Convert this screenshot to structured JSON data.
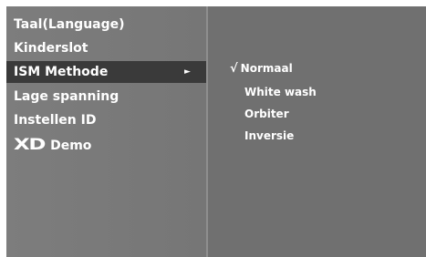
{
  "menu": {
    "items": [
      {
        "label": "Taal(Language)"
      },
      {
        "label": "Kinderslot"
      },
      {
        "label": "ISM Methode"
      },
      {
        "label": "Lage spanning"
      },
      {
        "label": "Instellen ID"
      },
      {
        "label": "Demo",
        "logo": "XD"
      }
    ],
    "selected_index": 2,
    "selected_arrow": "►"
  },
  "submenu": {
    "check_mark": "√",
    "options": [
      {
        "label": "Normaal",
        "checked": true
      },
      {
        "label": "White wash",
        "checked": false
      },
      {
        "label": "Orbiter",
        "checked": false
      },
      {
        "label": "Inversie",
        "checked": false
      }
    ]
  },
  "colors": {
    "panel_bg": "#6d6d6d",
    "selected_bg": "#3a3a3a",
    "text": "#ffffff"
  }
}
